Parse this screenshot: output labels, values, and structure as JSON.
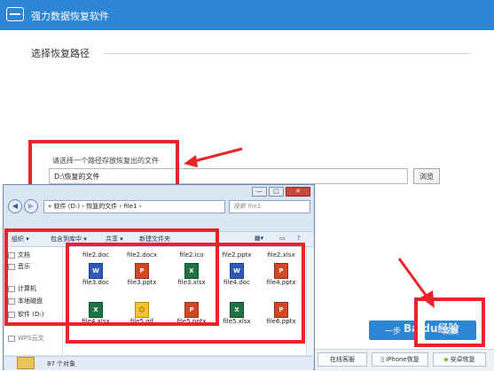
{
  "app": {
    "title": "强力数据恢复软件"
  },
  "section": {
    "title": "选择恢复路径"
  },
  "path": {
    "prompt": "请选择一个路径存放恢复出的文件",
    "value": "D:\\恢复的文件",
    "browse_label": "浏览"
  },
  "buttons": {
    "next_label": "一步",
    "recover_label": "恢复"
  },
  "bottom_bar": {
    "items": [
      {
        "label": "在线客服"
      },
      {
        "label": "iPhone恢复"
      },
      {
        "label": "安卓恢复"
      }
    ]
  },
  "watermark": "Baidu经验",
  "explorer": {
    "window_controls": [
      "—",
      "□",
      "✕"
    ],
    "address": "« 软件 (D:) › 恢复的文件 › file1 ›",
    "search_placeholder": "搜索 file1",
    "toolbar": [
      {
        "label": "组织 ▾"
      },
      {
        "label": "包含到库中 ▾"
      },
      {
        "label": "共享 ▾"
      },
      {
        "label": "新建文件夹"
      }
    ],
    "nav_items": [
      {
        "label": "文档"
      },
      {
        "label": "音乐"
      },
      {
        "label": "计算机"
      },
      {
        "label": "本地磁盘"
      },
      {
        "label": "软件 (D:)"
      },
      {
        "label": "WPS云文"
      }
    ],
    "files": [
      {
        "name": "file2.doc",
        "icon": "blank-icon",
        "glyph": ""
      },
      {
        "name": "file2.docx",
        "icon": "blank-icon",
        "glyph": ""
      },
      {
        "name": "file2.ico",
        "icon": "blank-icon",
        "glyph": ""
      },
      {
        "name": "file2.pptx",
        "icon": "blank-icon",
        "glyph": ""
      },
      {
        "name": "file2.xlsx",
        "icon": "blank-icon",
        "glyph": ""
      },
      {
        "name": "file3.doc",
        "icon": "word-icon",
        "glyph": "W"
      },
      {
        "name": "file3.pptx",
        "icon": "ppt-icon",
        "glyph": "P"
      },
      {
        "name": "file3.xlsx",
        "icon": "excel-icon",
        "glyph": "X"
      },
      {
        "name": "file4.doc",
        "icon": "word-icon",
        "glyph": "W"
      },
      {
        "name": "file4.pptx",
        "icon": "ppt-icon",
        "glyph": "P"
      },
      {
        "name": "file4.xlsx",
        "icon": "excel-icon",
        "glyph": "X"
      },
      {
        "name": "file5.gif",
        "icon": "gif-icon",
        "glyph": "☺"
      },
      {
        "name": "file5.pptx",
        "icon": "ppt-icon",
        "glyph": "P"
      },
      {
        "name": "file5.xlsx",
        "icon": "excel-icon",
        "glyph": "X"
      },
      {
        "name": "file6.pptx",
        "icon": "ppt-icon",
        "glyph": "P"
      }
    ],
    "status": "87 个对象"
  },
  "colors": {
    "accent": "#2c86d4",
    "highlight": "#e8232a"
  }
}
